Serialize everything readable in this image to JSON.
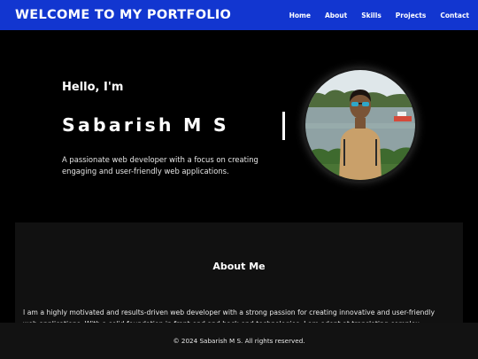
{
  "navbar": {
    "brand": "WELCOME TO MY PORTFOLIO",
    "links": [
      "Home",
      "About",
      "Skills",
      "Projects",
      "Contact"
    ],
    "background": "#1236d0"
  },
  "hero": {
    "greeting": "Hello, I'm",
    "name": "Sabarish M S",
    "tagline": "A passionate web developer with a focus on creating engaging and user-friendly web applications.",
    "avatar_icon": "profile-photo"
  },
  "about": {
    "title": "About Me",
    "text": "I am a highly motivated and results-driven web developer with a strong passion for creating innovative and user-friendly web applications. With a solid foundation in front-end and back-end technologies, I am adept at translating complex business"
  },
  "footer": {
    "text": "© 2024 Sabarish M S. All rights reserved."
  }
}
